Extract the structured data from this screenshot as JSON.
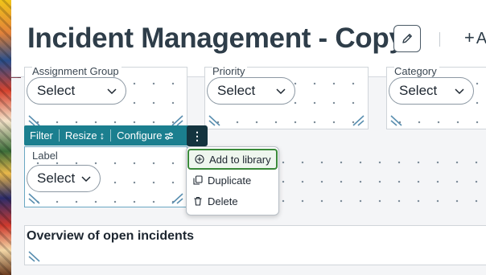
{
  "header": {
    "title": "Incident Management - Copy",
    "edit_icon": "pencil-icon",
    "add_label": "A",
    "add_icon": "plus-icon"
  },
  "widgets": [
    {
      "label": "Assignment Group",
      "select_value": "Select"
    },
    {
      "label": "Priority",
      "select_value": "Select"
    },
    {
      "label": "Category",
      "select_value": "Select"
    },
    {
      "label": "Label",
      "select_value": "Select"
    }
  ],
  "toolbar": {
    "filter": "Filter",
    "resize": "Resize",
    "resize_icon": "↕",
    "configure": "Configure",
    "configure_icon": "sliders-icon",
    "more_icon": "⋮"
  },
  "menu": {
    "items": [
      {
        "label": "Add to library",
        "icon": "plus-circle-icon"
      },
      {
        "label": "Duplicate",
        "icon": "copy-icon"
      },
      {
        "label": "Delete",
        "icon": "trash-icon"
      }
    ]
  },
  "overview": {
    "title": "Overview of open incidents"
  },
  "colors": {
    "toolbar": "#1b7f8f",
    "kebab": "#14343f",
    "menu_highlight": "#3a8a3a",
    "resize_handle": "#5a8fb0"
  }
}
